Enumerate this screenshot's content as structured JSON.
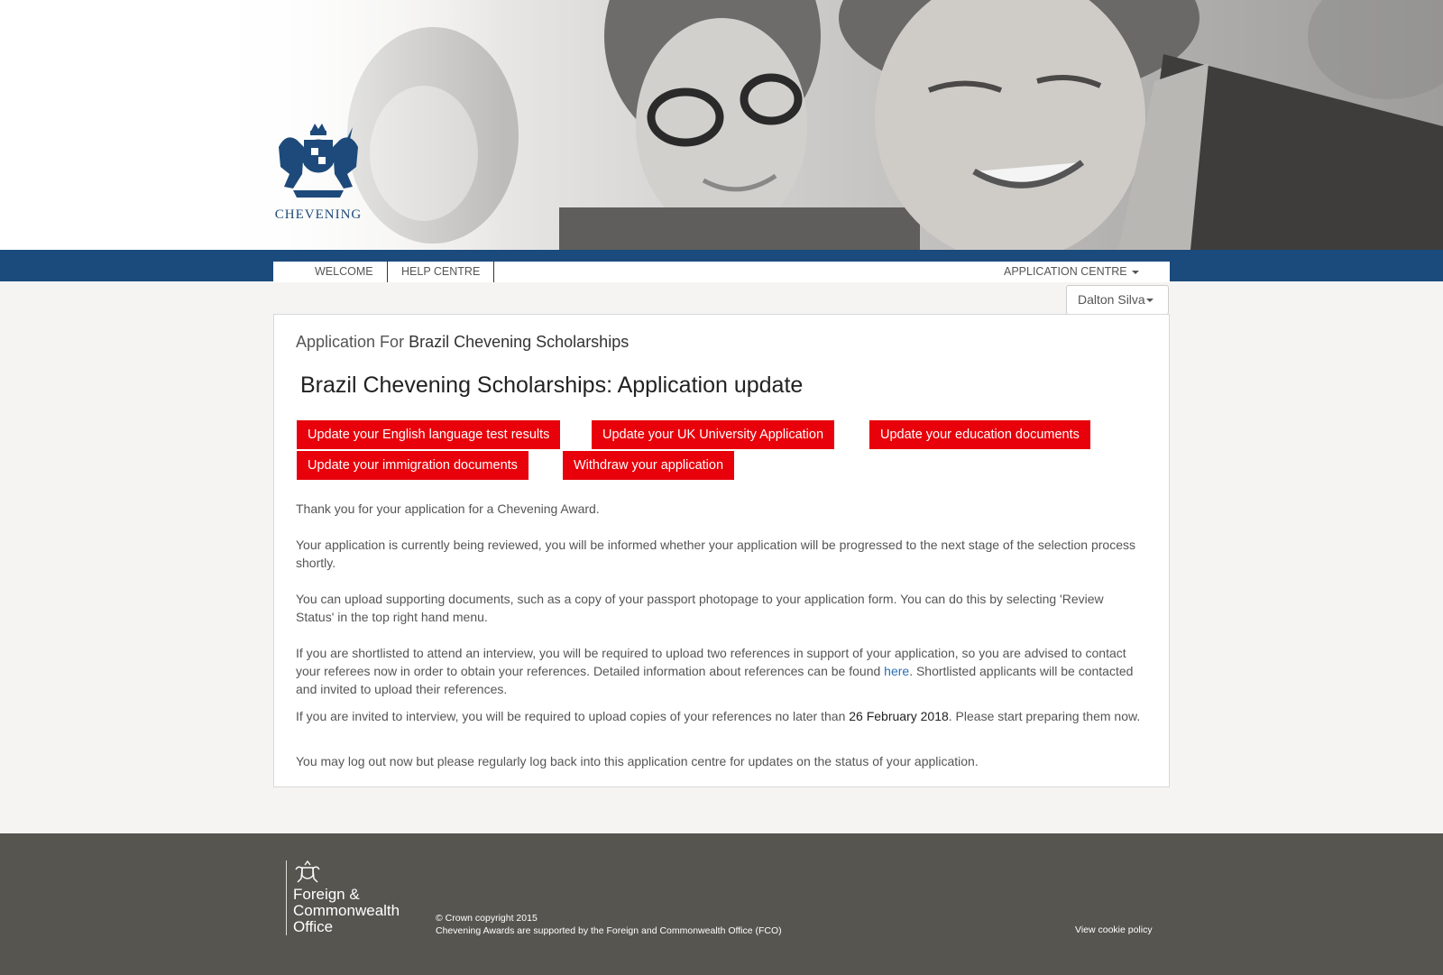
{
  "brand": {
    "name": "CHEVENING"
  },
  "nav": {
    "items": [
      "WELCOME",
      "HELP CENTRE"
    ],
    "app_centre": "APPLICATION CENTRE",
    "user": "Dalton Silva"
  },
  "main": {
    "application_for_label": "Application For",
    "scheme": "Brazil Chevening Scholarships",
    "title": "Brazil Chevening Scholarships: Application update",
    "buttons": [
      "Update your English language test results",
      "Update your UK University Application",
      "Update your education documents",
      "Update your immigration documents",
      "Withdraw your application"
    ],
    "para1": "Thank you for your application for a Chevening Award.",
    "para2": "Your application is currently being reviewed, you will be informed whether your application will be progressed to the next stage of the selection process shortly.",
    "para3": "You can upload supporting documents, such as a copy of your passport photopage to your application form. You can do this by selecting 'Review Status' in the top right hand menu.",
    "para4_before": "If you are shortlisted to attend an interview, you will be required to upload two references in support of your application, so you are advised to contact your referees now in order to obtain your references. Detailed information about references can be found ",
    "para4_link": "here",
    "para4_after": ". Shortlisted applicants will be contacted and invited to upload their references.",
    "para5_before": "If you are invited to interview, you will be required to upload copies of your references no later than ",
    "para5_date": "26 February 2018",
    "para5_after": ". Please start preparing them now.",
    "para6": "You may log out now but please regularly log back into this application centre for updates on the status of your application."
  },
  "footer": {
    "org_line1": "Foreign &",
    "org_line2": "Commonwealth",
    "org_line3": "Office",
    "copyright": "© Crown copyright 2015",
    "supported": "Chevening Awards are supported by the Foreign and Commonwealth Office (FCO)",
    "cookie": "View cookie policy"
  },
  "colors": {
    "nav_blue": "#1b4a7d",
    "button_red": "#e8000a",
    "footer_grey": "#565550",
    "link_blue": "#2a6fb5"
  }
}
